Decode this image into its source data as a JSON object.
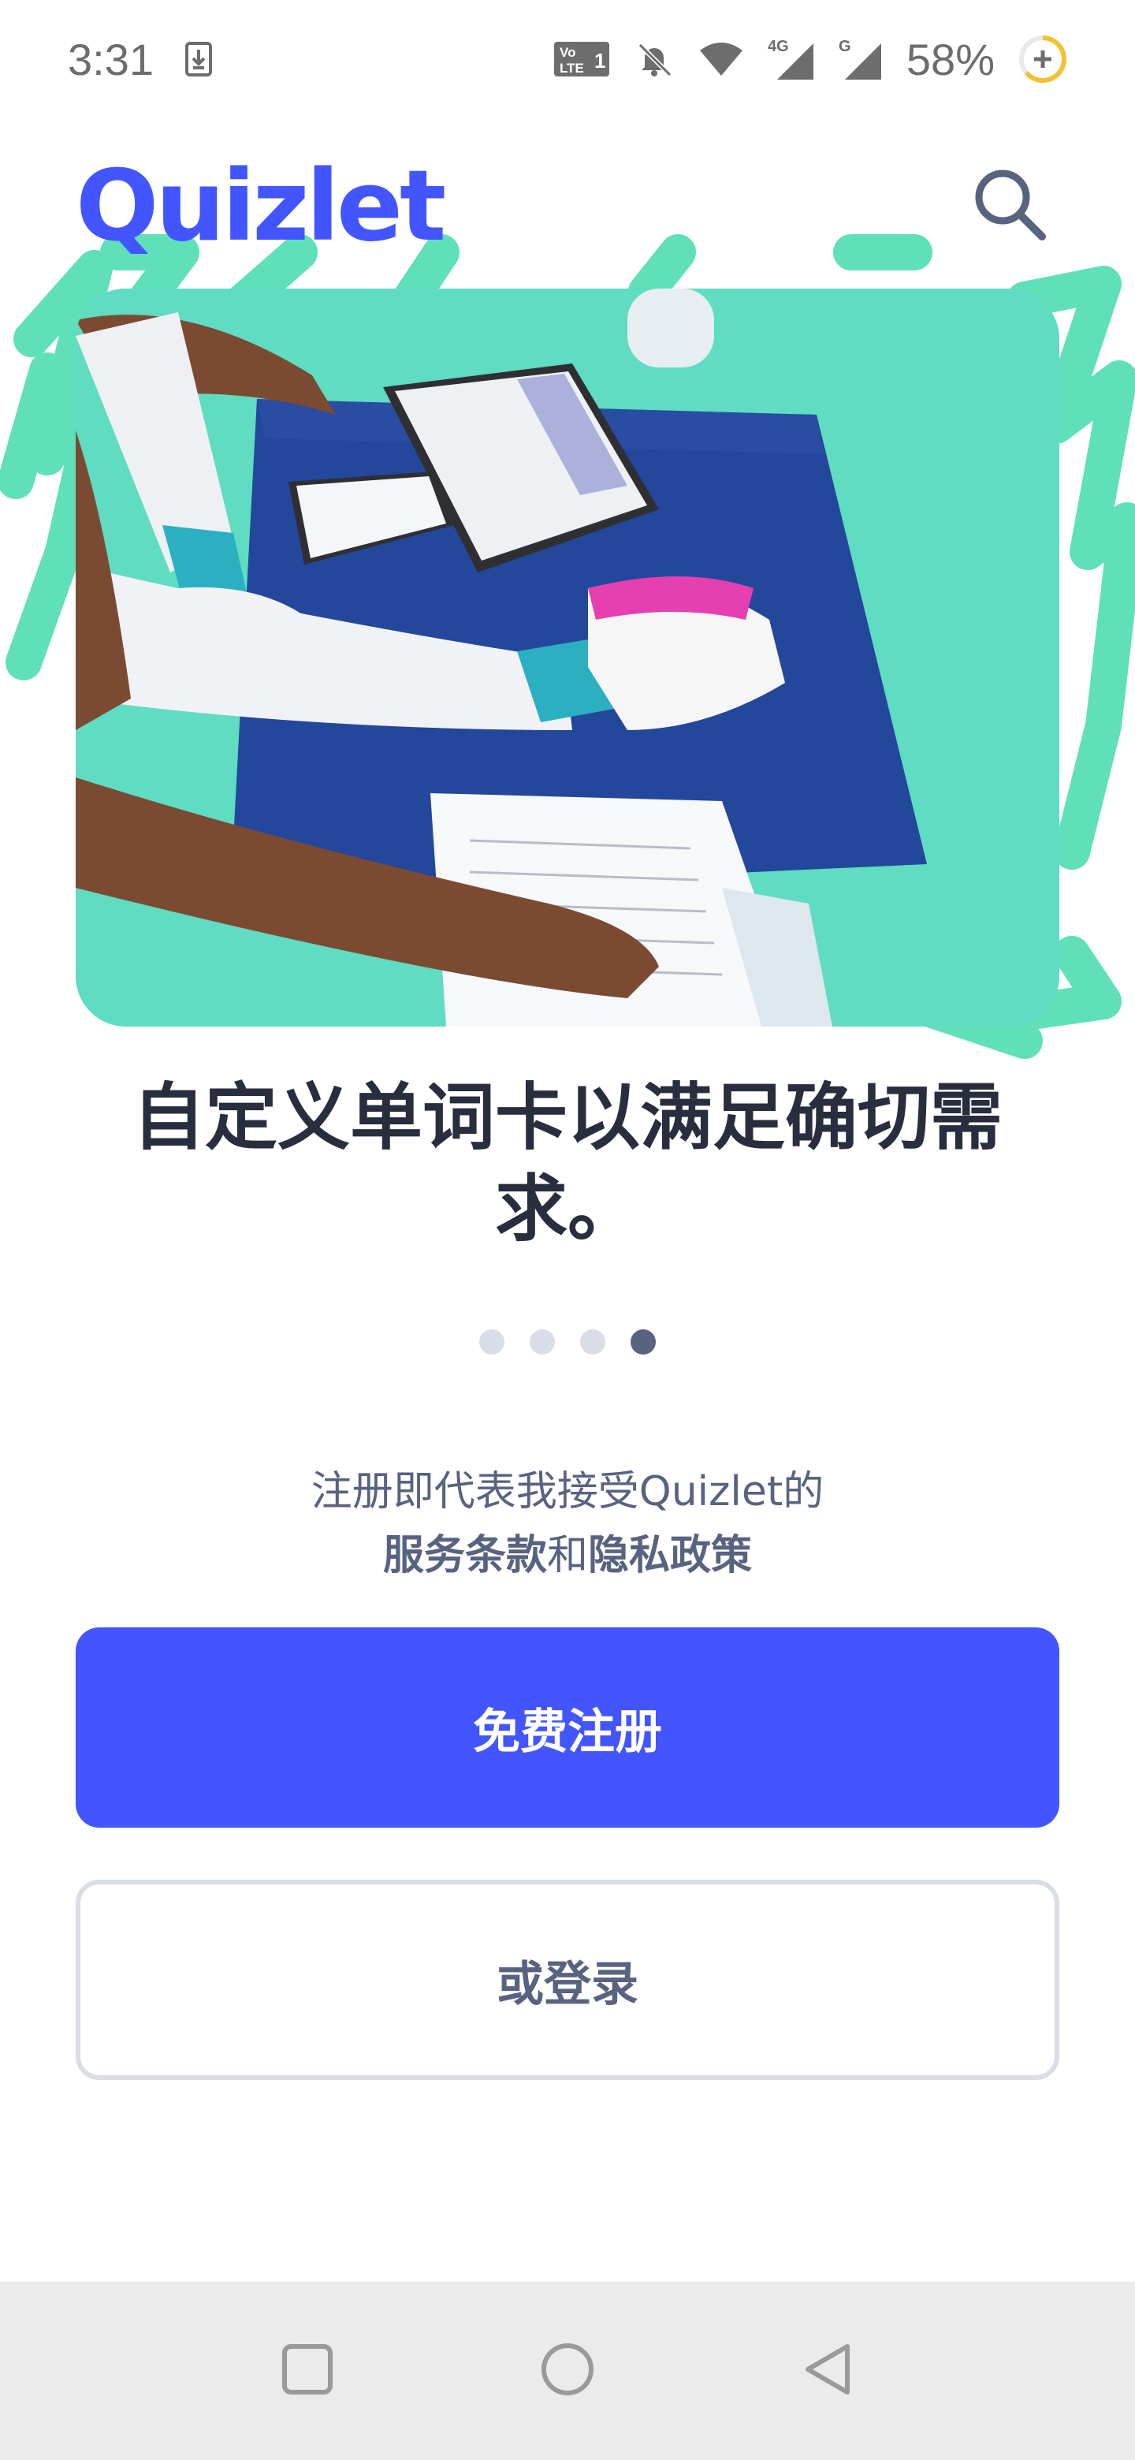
{
  "status_bar": {
    "time": "3:31",
    "volte": "Vo LTE 1",
    "network_4g": "4G",
    "network_g": "G",
    "battery": "58%",
    "icons": [
      "download-notification-icon",
      "volte-icon",
      "bell-muted-icon",
      "wifi-icon",
      "signal-4g-icon",
      "signal-g-icon",
      "battery-saver-icon"
    ]
  },
  "header": {
    "logo": "Quizlet",
    "search_icon": "search-icon"
  },
  "hero": {
    "image_description_icon": "hero-photo"
  },
  "headline": "自定义单词卡以满足确切需求。",
  "pager": {
    "count": 4,
    "active_index": 3
  },
  "terms": {
    "line1": "注册即代表我接受Quizlet的",
    "terms_link": "服务条款",
    "and": "和",
    "privacy_link": "隐私政策"
  },
  "buttons": {
    "signup": "免费注册",
    "login": "或登录"
  },
  "colors": {
    "brand": "#4255ff",
    "accent_green": "#5fdcc1",
    "text_dark": "#282e3e",
    "text_muted": "#586380",
    "border": "#d9dde8",
    "nav_bg": "#ebebeb"
  },
  "nav_bar": {
    "icons": [
      "recents-square-icon",
      "home-circle-icon",
      "back-triangle-icon"
    ]
  }
}
